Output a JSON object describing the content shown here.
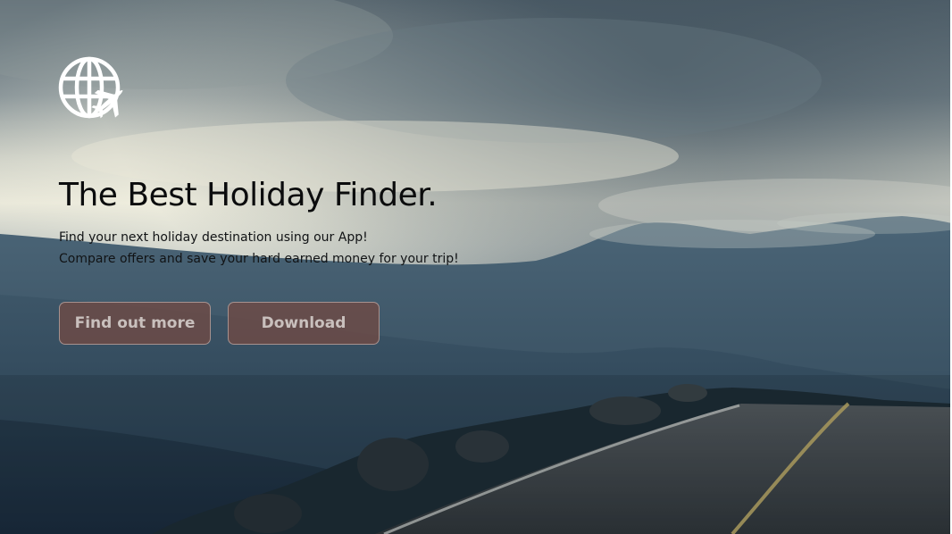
{
  "hero": {
    "title": "The Best Holiday Finder.",
    "subtitle_line1": "Find your next holiday destination using our App!",
    "subtitle_line2": "Compare offers and save your hard earned money for your trip!",
    "logo_icon": "globe-airplane-icon"
  },
  "actions": {
    "find_out_more_label": "Find out more",
    "download_label": "Download"
  },
  "colors": {
    "button_background": "#6e4b46",
    "button_text": "#c9c0bd",
    "title_text": "#0b0c0d",
    "logo": "#ffffff"
  }
}
